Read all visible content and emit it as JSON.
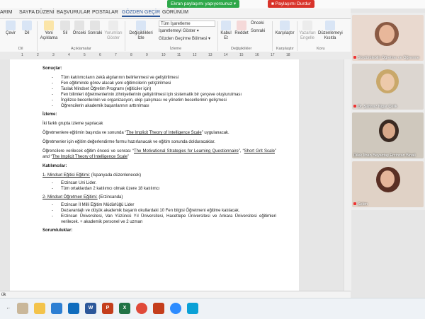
{
  "share_bar": {
    "sharing_text": "Ekran paylaşımı yapıyorsunuz",
    "stop_label": "Paylaşımı Durdur"
  },
  "tabs": [
    "ARIM",
    "SAYFA DÜZENİ",
    "BAŞVURULAR",
    "POSTALAR",
    "GÖZDEN GEÇİR",
    "GÖRÜNÜM"
  ],
  "ribbon": {
    "buttons": {
      "cevir": "Çevir",
      "dil": "Dil",
      "yeni_aciklama": "Yeni Açıklama",
      "sil": "Sil",
      "onceki": "Önceki",
      "sonraki": "Sonraki",
      "yorumlari_goster": "Yorumları Göster",
      "degisiklikleri_izle": "Değişiklikleri İzle",
      "kabul_et": "Kabul Et",
      "reddet": "Reddet",
      "karsilastir": "Karşılaştır",
      "yazarlari_engelle": "Yazarları Engelle",
      "duzenlemeyi_kisitla": "Düzenlemeyi Kısıtla"
    },
    "dropdowns": {
      "markup": "Tüm İşaretleme",
      "show_markup": "İşaretlemeyi Göster",
      "pane": "Gözden Geçirme Bölmesi"
    },
    "small": {
      "onceki": "Önceki",
      "sonraki": "Sonraki"
    },
    "groups": {
      "dil": "Dil",
      "aciklamalar": "Açıklamalar",
      "izleme": "İzleme",
      "degisiklikler": "Değişiklikler",
      "karsilastir": "Karşılaştır",
      "koru": "Koru"
    }
  },
  "ruler": [
    "1",
    "2",
    "3",
    "4",
    "5",
    "6",
    "7",
    "8",
    "9",
    "10",
    "11",
    "12",
    "13",
    "14",
    "15",
    "16",
    "17",
    "18"
  ],
  "doc": {
    "sonuclar_heading": "Sonuçlar:",
    "sonuclar": [
      "Tüm katılımcıların zekâ algılarının belirlenmesi ve geliştirilmesi",
      "Fen eğitiminde görev alacak yeni eğitimcilerin yetiştirilmesi",
      "Taslak Mindset Öğretim Programı (eğiticiler için)",
      "Fen bilimleri öğretmenlerinin zihniyetlerinin geliştirilmesi için sistematik bir çerçeve oluşturulması",
      "İngilizce becerilerinin ve organizasyon, ekip çalışması ve yönetim becerilerinin gelişmesi",
      "Öğrencilerin akademik başarılarının arttırılması"
    ],
    "izleme_heading": "İzleme:",
    "izleme_p1": "İki farklı grupta izleme yapılacak",
    "izleme_p2_pre": "Öğretmenlere eğitimin başında ve sonunda “",
    "izleme_p2_title": "The Implicit Theory of Intelligence Scale",
    "izleme_p2_post": "” uygulanacak.",
    "izleme_p3": "Öğretmenler için eğitim değerlendirme formu hazırlanacak ve eğitim sonunda dolduracaklar.",
    "izleme_p4_pre": "Öğrencilere verilecek eğitim öncesi ve sonrası “",
    "izleme_p4_t1": "The Motivational Strategies for Learning Questionnaire",
    "izleme_p4_mid1": "”, “",
    "izleme_p4_t2": "Short Grit Scale",
    "izleme_p4_mid2": "” and “",
    "izleme_p4_t3": "The Implicit Theory of Intelligence Scale",
    "izleme_p4_post": "”",
    "katilimcilar_heading": "Katılımcılar:",
    "item1_title": "1- Mindset Eğitici Eğitimi:",
    "item1_note": " (İspanyada düzenlenecek)",
    "item1_list": [
      "Erzincan Uni Lider.",
      "Tüm ortaklardan 2 katılımcı olmak üzere 18 katılımcı"
    ],
    "item2_title": "2- Mindset Öğretmen Eğitimi:",
    "item2_note": " (Erzincanda)",
    "item2_list": [
      "Erzincan İl Milli Eğitim Müdürlüğü Lider",
      "Dezavantajlı ve düşük akademik başarılı okullardaki 10 Fen bilgisi Öğretmeni eğitime katılacak.",
      "Erzincan Üniversitesi, Van Yüzüncü Yıl Üniversitesi, Hacettepe Üniversitesi ve Ankara Üniversitesi eğitimleri verilecek. + akademik personel ve 2 uzman"
    ],
    "sorumluluklar_heading": "Sorumluluklar:"
  },
  "status": {
    "left": "ük"
  },
  "participants": [
    {
      "name": "Sürdürülebilir Öğretme ve Öğrenme",
      "bg": "#e9d9cf"
    },
    {
      "name": "Dr. Şahnaz Nigar Çelik",
      "bg": "#dcd6d0"
    },
    {
      "name": "Dilek İlhan Beyaztaş Erzincan Binali",
      "bg": "#cfc8bd"
    },
    {
      "name": "Selen",
      "bg": "#e0d2c6"
    }
  ],
  "colors": {
    "accent": "#2b579a",
    "share_green": "#2ea84a",
    "stop_red": "#d9342b"
  }
}
